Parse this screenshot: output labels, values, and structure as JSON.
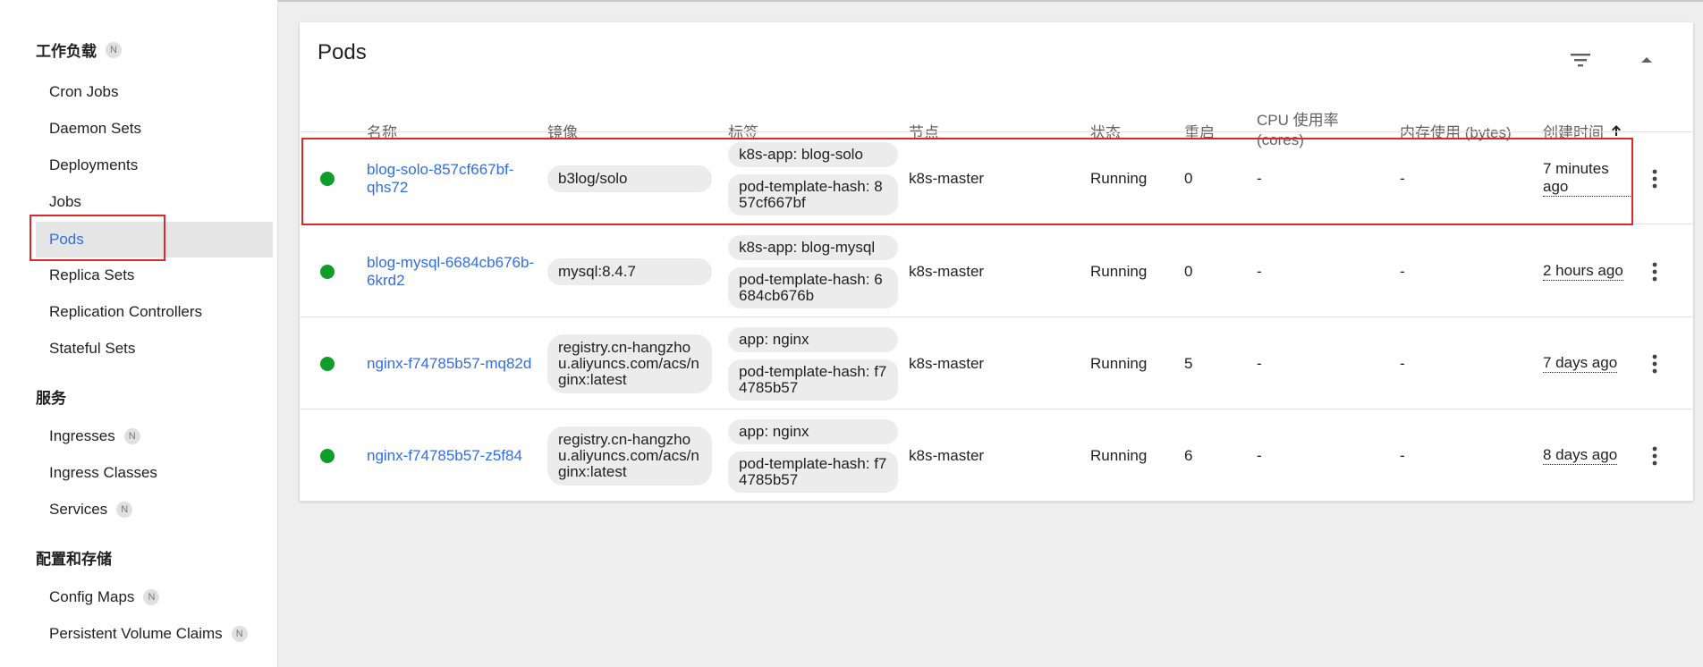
{
  "sidebar": {
    "sections": [
      {
        "title": "工作负载",
        "badge": "N"
      },
      {
        "title": "服务",
        "badge": ""
      },
      {
        "title": "配置和存储",
        "badge": ""
      }
    ],
    "workloads": [
      "Cron Jobs",
      "Daemon Sets",
      "Deployments",
      "Jobs",
      "Pods",
      "Replica Sets",
      "Replication Controllers",
      "Stateful Sets"
    ],
    "services": [
      {
        "label": "Ingresses",
        "badge": "N"
      },
      {
        "label": "Ingress Classes",
        "badge": ""
      },
      {
        "label": "Services",
        "badge": "N"
      }
    ],
    "config": [
      {
        "label": "Config Maps",
        "badge": "N"
      },
      {
        "label": "Persistent Volume Claims",
        "badge": "N"
      }
    ],
    "active": "Pods"
  },
  "card": {
    "title": "Pods",
    "icons": {
      "filter": "filter-list-icon",
      "collapse": "arrow-drop-up-icon"
    }
  },
  "table": {
    "headers": {
      "name": "名称",
      "image": "镜像",
      "labels": "标签",
      "node": "节点",
      "status": "状态",
      "restarts": "重启",
      "cpu": "CPU 使用率 (cores)",
      "memory": "内存使用 (bytes)",
      "created": "创建时间"
    },
    "rows": [
      {
        "name": "blog-solo-857cf667bf-qhs72",
        "image": "b3log/solo",
        "labels": [
          "k8s-app: blog-solo",
          "pod-template-hash: 857cf667bf"
        ],
        "node": "k8s-master",
        "status": "Running",
        "restarts": "0",
        "cpu": "-",
        "memory": "-",
        "created": "7 minutes ago"
      },
      {
        "name": "blog-mysql-6684cb676b-6krd2",
        "image": "mysql:8.4.7",
        "labels": [
          "k8s-app: blog-mysql",
          "pod-template-hash: 6684cb676b"
        ],
        "node": "k8s-master",
        "status": "Running",
        "restarts": "0",
        "cpu": "-",
        "memory": "-",
        "created": "2 hours ago"
      },
      {
        "name": "nginx-f74785b57-mq82d",
        "image": "registry.cn-hangzhou.aliyuncs.com/acs/nginx:latest",
        "labels": [
          "app: nginx",
          "pod-template-hash: f74785b57"
        ],
        "node": "k8s-master",
        "status": "Running",
        "restarts": "5",
        "cpu": "-",
        "memory": "-",
        "created": "7 days ago"
      },
      {
        "name": "nginx-f74785b57-z5f84",
        "image": "registry.cn-hangzhou.aliyuncs.com/acs/nginx:latest",
        "labels": [
          "app: nginx",
          "pod-template-hash: f74785b57"
        ],
        "node": "k8s-master",
        "status": "Running",
        "restarts": "6",
        "cpu": "-",
        "memory": "-",
        "created": "8 days ago"
      }
    ]
  },
  "colors": {
    "accent": "#326de6",
    "running": "#0f9d29",
    "highlight": "#e0252b"
  }
}
